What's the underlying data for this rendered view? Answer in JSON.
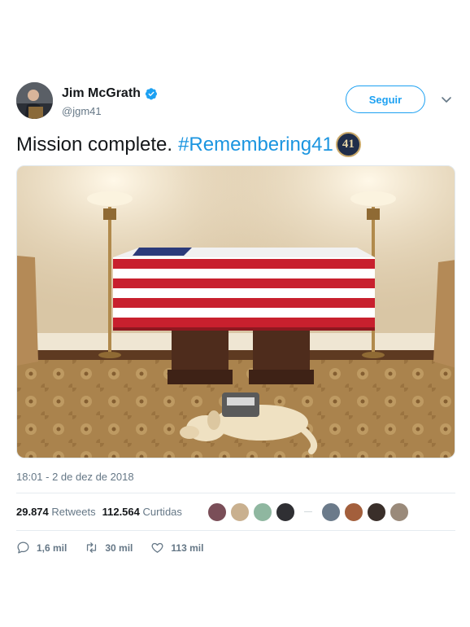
{
  "tweet": {
    "author": {
      "name": "Jim McGrath",
      "handle": "@jgm41",
      "verified": true
    },
    "follow_label": "Seguir",
    "text": "Mission complete.",
    "hashtag": "#Remembering41",
    "emoji_label": "41",
    "timestamp": "18:01 - 2 de dez de 2018",
    "stats": {
      "retweets_count": "29.874",
      "retweets_label": "Retweets",
      "likes_count": "112.564",
      "likes_label": "Curtidas"
    },
    "actions": {
      "replies": "1,6 mil",
      "retweets": "30 mil",
      "likes": "113 mil"
    },
    "colors": {
      "accent": "#1da1f2",
      "hashtag": "#1b95e0",
      "muted": "#657786",
      "text": "#14171a"
    },
    "icons": [
      "verified-badge-icon",
      "chevron-down-icon",
      "reply-icon",
      "retweet-icon",
      "like-icon"
    ]
  }
}
